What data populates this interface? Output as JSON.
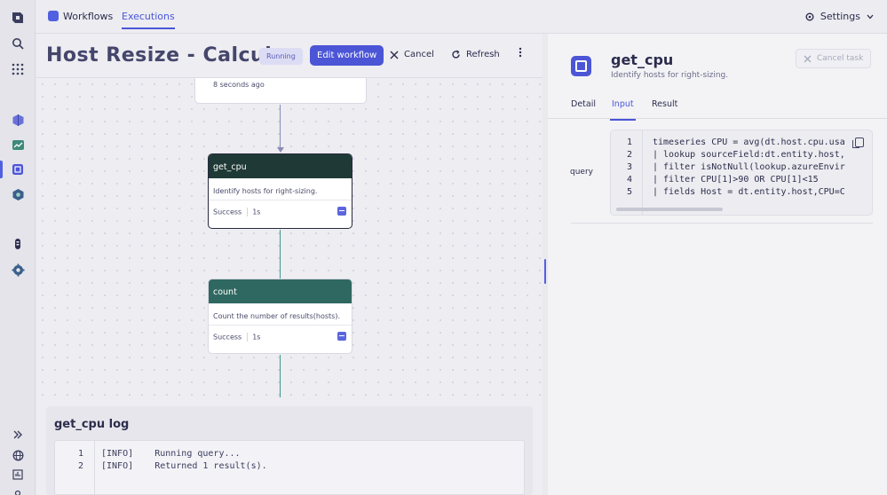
{
  "app": {
    "tabs": [
      {
        "label": "Workflows",
        "active": false
      },
      {
        "label": "Executions",
        "active": true
      }
    ],
    "settings_label": "Settings"
  },
  "rail": {
    "icons": [
      "dynatrace-logo-icon",
      "search-icon",
      "apps-grid-icon",
      "cube-icon",
      "chart-icon",
      "workflows-icon",
      "hexagon-icon",
      "robot-icon",
      "gear-icon",
      "expand-icon",
      "globe-icon",
      "report-icon"
    ]
  },
  "workflow": {
    "title": "Host Resize - Calcul…",
    "status": "Running",
    "edit_label": "Edit workflow",
    "cancel_label": "Cancel",
    "refresh_label": "Refresh"
  },
  "canvas": {
    "prev_node_time": "8 seconds ago",
    "nodes": [
      {
        "name": "get_cpu",
        "description": "Identify hosts for right-sizing.",
        "status": "Success",
        "duration": "1s",
        "color": "#1f3a36"
      },
      {
        "name": "count",
        "description": "Count the number of results(hosts).",
        "status": "Success",
        "duration": "1s",
        "color": "#2f6860"
      }
    ]
  },
  "log": {
    "title": "get_cpu log",
    "lines": [
      {
        "num": "1",
        "text": "[INFO]    Running query..."
      },
      {
        "num": "2",
        "text": "[INFO]    Returned 1 result(s)."
      }
    ]
  },
  "task": {
    "name": "get_cpu",
    "description": "Identify hosts for right-sizing.",
    "cancel_label": "Cancel task",
    "tabs": [
      {
        "label": "Detail",
        "active": false
      },
      {
        "label": "Input",
        "active": true
      },
      {
        "label": "Result",
        "active": false
      }
    ],
    "query_label": "query",
    "query_lines": [
      {
        "num": "1",
        "text": "timeseries CPU = avg(dt.host.cpu.usa"
      },
      {
        "num": "2",
        "text": "| lookup sourceField:dt.entity.host,"
      },
      {
        "num": "3",
        "text": "| filter isNotNull(lookup.azureEnvir"
      },
      {
        "num": "4",
        "text": "| filter CPU[1]>90 OR CPU[1]<15"
      },
      {
        "num": "5",
        "text": "| fields Host = dt.entity.host,CPU=C"
      }
    ]
  }
}
